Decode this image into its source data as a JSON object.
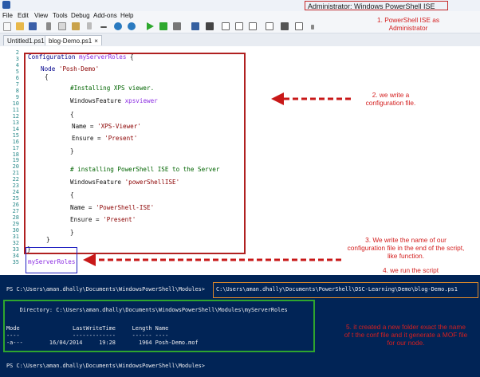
{
  "window": {
    "title": "Administrator: Windows PowerShell ISE"
  },
  "menu": [
    "File",
    "Edit",
    "View",
    "Tools",
    "Debug",
    "Add-ons",
    "Help"
  ],
  "tabs": [
    {
      "label": "Untitled1.ps1"
    },
    {
      "label": "blog-Demo.ps1",
      "close": "×"
    }
  ],
  "editor": {
    "line_numbers": [
      "2",
      "3",
      "4",
      "5",
      "6",
      "7",
      "8",
      "9",
      "10",
      "11",
      "12",
      "13",
      "14",
      "15",
      "16",
      "17",
      "18",
      "19",
      "20",
      "21",
      "22",
      "23",
      "24",
      "25",
      "26",
      "27",
      "28",
      "29",
      "30",
      "31",
      "32",
      "33",
      "34",
      "35"
    ],
    "code": {
      "l2_kw": "Configuration",
      "l2_name": "myServerRoles",
      "l2_brace": " {",
      "l3_kw": "Node",
      "l3_str": "'Posh-Demo'",
      "l4": "{",
      "l5": "#Installing XPS viewer.",
      "l6_cmd": "WindowsFeature",
      "l6_name": "xpsviewer",
      "l7": "{",
      "l8_a": "Name = ",
      "l8_b": "'XPS-Viewer'",
      "l9_a": "Ensure = ",
      "l9_b": "'Present'",
      "l10": "}",
      "l11": "# installing PowerShell ISE to the Server",
      "l12_cmd": "WindowsFeature",
      "l12_str": "'powerShellISE'",
      "l13": "{",
      "l14_a": "Name = ",
      "l14_b": "'PowerShell-ISE'",
      "l15_a": "Ensure = ",
      "l15_b": "'Present'",
      "l16": "}",
      "l17": "}",
      "l18": "}",
      "call": "myServerRoles"
    }
  },
  "annotations": {
    "n1": "1. PowerShell ISE as Administrator",
    "n2": "2. we write a configuration file.",
    "n3": "3. We write the name of our configuration file in the end of the script, like function.",
    "n4": "4. we run the script",
    "n5": "5. it created a new folder exact the name of t the conf file and it generate a MOF file for our node."
  },
  "console": {
    "prompt1": "PS C:\\Users\\aman.dhally\\Documents\\WindowsPowerShell\\Modules>",
    "command": "C:\\Users\\aman.dhally\\Documents\\PowerShell\\DSC-Learning\\Demo\\blog-Demo.ps1",
    "directory": "    Directory: C:\\Users\\aman.dhally\\Documents\\WindowsPowerShell\\Modules\\myServerRoles",
    "headers": "Mode                LastWriteTime     Length Name",
    "underline": "----                -------------     ------ ----",
    "row": "-a---        16/04/2014     19:28       1964 Posh-Demo.mof",
    "prompt2": "PS C:\\Users\\aman.dhally\\Documents\\WindowsPowerShell\\Modules>"
  }
}
